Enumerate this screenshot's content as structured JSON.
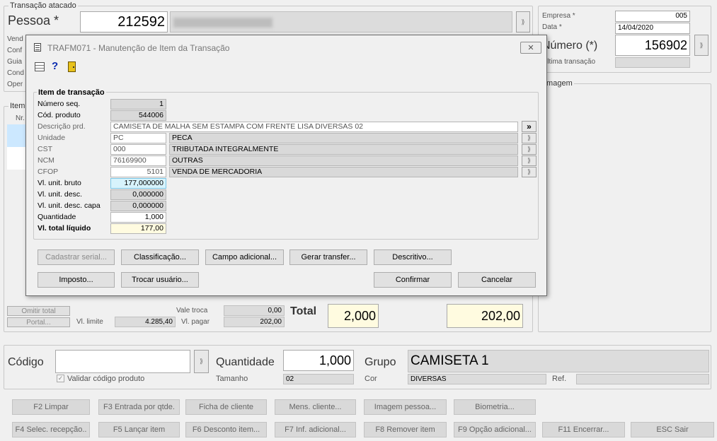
{
  "main": {
    "transaction_group_title": "Transação atacado",
    "pessoa_label": "Pessoa *",
    "pessoa_code": "212592",
    "side_labels": [
      "Vend",
      "Conf",
      "Guia",
      "Cond",
      "Oper"
    ],
    "items_group_title": "Item",
    "items_col_nr": "Nr.",
    "empresa_label": "Empresa *",
    "empresa_value": "005",
    "data_label": "Data *",
    "data_value": "14/04/2020",
    "numero_label": "Número (*)",
    "numero_value": "156902",
    "ultima_label": "Última transação",
    "imagem_group_title": "Imagem",
    "omitir_total_label": "Omitir total",
    "portal_label": "Portal...",
    "vl_limite_label": "Vl. limite",
    "vl_limite_value": "4.285,40",
    "vale_troca_label": "Vale troca",
    "vale_troca_value": "0,00",
    "vl_pagar_label": "Vl. pagar",
    "vl_pagar_value": "202,00",
    "total_label": "Total",
    "total_qty": "2,000",
    "total_value": "202,00"
  },
  "entry": {
    "codigo_label": "Código",
    "validar_label": "Validar código produto",
    "quantidade_label": "Quantidade",
    "quantidade_value": "1,000",
    "tamanho_label": "Tamanho",
    "tamanho_value": "02",
    "grupo_label": "Grupo",
    "grupo_value": "CAMISETA 1",
    "cor_label": "Cor",
    "cor_value": "DIVERSAS",
    "ref_label": "Ref."
  },
  "fkeys_row1": [
    "F2 Limpar",
    "F3 Entrada por qtde.",
    "Ficha de cliente",
    "Mens. cliente...",
    "Imagem pessoa...",
    "Biometria..."
  ],
  "fkeys_row2": [
    "F4 Selec. recepção..",
    "F5 Lançar item",
    "F6 Desconto item...",
    "F7 Inf. adicional...",
    "F8 Remover item",
    "F9 Opção adicional...",
    "F11 Encerrar...",
    "ESC Sair"
  ],
  "dialog": {
    "title": "TRAFM071 - Manutenção de Item da Transação",
    "close_label": "✕",
    "group_title": "Item de transação",
    "fields": {
      "numero_seq_label": "Número seq.",
      "numero_seq_value": "1",
      "cod_produto_label": "Cód. produto",
      "cod_produto_value": "544006",
      "descricao_label": "Descrição prd.",
      "descricao_value": "CAMISETA DE MALHA SEM ESTAMPA COM FRENTE LISA DIVERSAS 02",
      "unidade_label": "Unidade",
      "unidade_value": "PC",
      "unidade_desc": "PECA",
      "cst_label": "CST",
      "cst_value": "000",
      "cst_desc": "TRIBUTADA INTEGRALMENTE",
      "ncm_label": "NCM",
      "ncm_value": "76169900",
      "ncm_desc": "OUTRAS",
      "cfop_label": "CFOP",
      "cfop_value": "5101",
      "cfop_desc": "VENDA DE MERCADORIA",
      "vl_unit_bruto_label": "Vl. unit. bruto",
      "vl_unit_bruto_value": "177,000000",
      "vl_unit_desc_label": "Vl. unit. desc.",
      "vl_unit_desc_value": "0,000000",
      "vl_unit_desc_capa_label": "Vl. unit. desc. capa",
      "vl_unit_desc_capa_value": "0,000000",
      "quantidade_label": "Quantidade",
      "quantidade_value": "1,000",
      "vl_total_liquido_label": "Vl. total líquido",
      "vl_total_liquido_value": "177,00"
    },
    "more_button": "»",
    "buttons_row1": [
      "Cadastrar serial...",
      "Classificação...",
      "Campo adicional...",
      "Gerar transfer...",
      "Descritivo..."
    ],
    "buttons_row2": [
      "Imposto...",
      "Trocar usuário...",
      "Confirmar",
      "Cancelar"
    ]
  }
}
